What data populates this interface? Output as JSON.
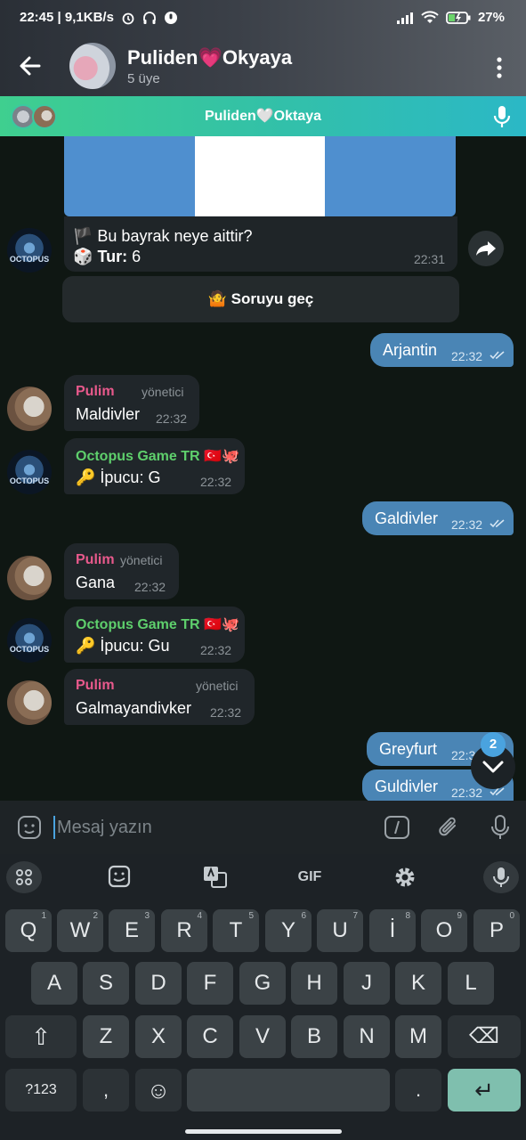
{
  "status": {
    "left": "22:45 | 9,1KB/s",
    "battery": "27"
  },
  "header": {
    "title": "Puliden💗Okyaya",
    "subtitle": "5 üye"
  },
  "voice_chat": {
    "title": "Puliden🤍Oktaya"
  },
  "quiz": {
    "question": "🏴 Bu bayrak neye aittir?",
    "tur_label": "Tur:",
    "tur_value": "6",
    "dice": "🎲",
    "time": "22:31",
    "skip": "🤷 Soruyu geç"
  },
  "messages": [
    {
      "dir": "out",
      "text": "Arjantin",
      "time": "22:32"
    },
    {
      "dir": "in",
      "sender": "Pulim",
      "admin": "yönetici",
      "text": "Maldivler",
      "time": "22:32"
    },
    {
      "dir": "in",
      "sender": "Octopus Game TR 🇹🇷🐙",
      "text": "🔑 İpucu: G",
      "time": "22:32"
    },
    {
      "dir": "out",
      "text": "Galdivler",
      "time": "22:32"
    },
    {
      "dir": "in",
      "sender": "Pulim",
      "admin": "yönetici",
      "text": "Gana",
      "time": "22:32"
    },
    {
      "dir": "in",
      "sender": "Octopus Game TR 🇹🇷🐙",
      "text": "🔑 İpucu: Gu",
      "time": "22:32"
    },
    {
      "dir": "in",
      "sender": "Pulim",
      "admin": "yönetici",
      "text": "Galmayandivker",
      "time": "22:32"
    },
    {
      "dir": "out",
      "text": "Greyfurt",
      "time": "22:3"
    },
    {
      "dir": "out",
      "text": "Guldivler",
      "time": "22:32"
    }
  ],
  "octopus_avatar_text": "OCTOPUS",
  "unread_count": "2",
  "input": {
    "placeholder": "Mesaj yazın"
  },
  "keyboard": {
    "toolbar": {
      "gif": "GIF"
    },
    "row1": [
      [
        "Q",
        "1"
      ],
      [
        "W",
        "2"
      ],
      [
        "E",
        "3"
      ],
      [
        "R",
        "4"
      ],
      [
        "T",
        "5"
      ],
      [
        "Y",
        "6"
      ],
      [
        "U",
        "7"
      ],
      [
        "İ",
        "8"
      ],
      [
        "O",
        "9"
      ],
      [
        "P",
        "0"
      ]
    ],
    "row2": [
      "A",
      "S",
      "D",
      "F",
      "G",
      "H",
      "J",
      "K",
      "L"
    ],
    "row3": [
      "Z",
      "X",
      "C",
      "V",
      "B",
      "N",
      "M"
    ],
    "numbers_key": "?123",
    "comma": ",",
    "period": ".",
    "shift_symbol": "⇧",
    "backspace_symbol": "⌫",
    "enter_symbol": "↵",
    "emoji_symbol": "☺"
  }
}
